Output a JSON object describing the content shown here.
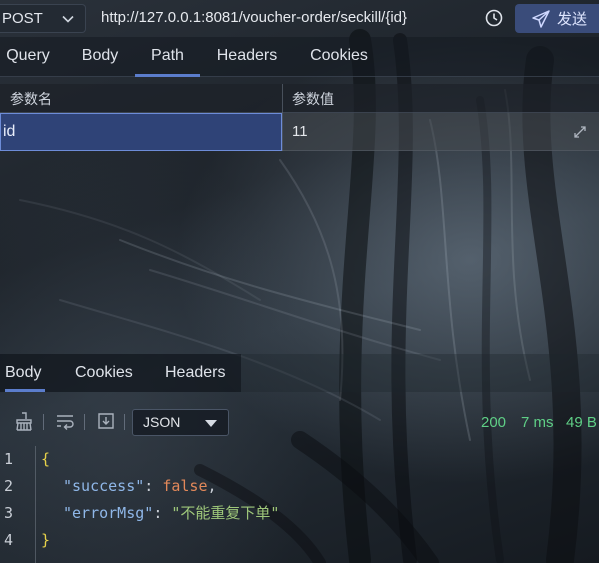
{
  "request": {
    "method": "POST",
    "url": "http://127.0.0.1:8081/voucher-order/seckill/{id}",
    "send_label": "发送"
  },
  "request_tabs": [
    {
      "label": "Query"
    },
    {
      "label": "Body"
    },
    {
      "label": "Path",
      "active": true
    },
    {
      "label": "Headers"
    },
    {
      "label": "Cookies"
    }
  ],
  "params": {
    "header_name": "参数名",
    "header_value": "参数值",
    "rows": [
      {
        "name": "id",
        "value": "11"
      }
    ]
  },
  "response": {
    "tabs": [
      {
        "label": "Body",
        "active": true
      },
      {
        "label": "Cookies"
      },
      {
        "label": "Headers"
      }
    ],
    "format": "JSON",
    "status_code": "200",
    "time": "7 ms",
    "size": "49 B",
    "line_numbers": [
      "1",
      "2",
      "3",
      "4"
    ],
    "body": {
      "open_brace": "{",
      "close_brace": "}",
      "key1": "\"success\"",
      "value1": "false",
      "key2": "\"errorMsg\"",
      "value2": "\"不能重复下单\""
    }
  },
  "colors": {
    "accent": "#5b7dcc",
    "selected_row": "#2f4377",
    "status_ok": "#5fcf86",
    "json_key": "#8fb7e8",
    "json_string": "#9ec77a",
    "json_bool": "#e2885a",
    "json_brace": "#e7d24a"
  },
  "icons": {
    "history": "clock-icon",
    "send": "paper-plane-icon",
    "clear": "broom-icon",
    "wrap": "wrap-lines-icon",
    "download": "download-icon",
    "expand": "expand-icon",
    "method_dropdown": "chevron-down-icon",
    "format_dropdown": "caret-down-icon"
  }
}
